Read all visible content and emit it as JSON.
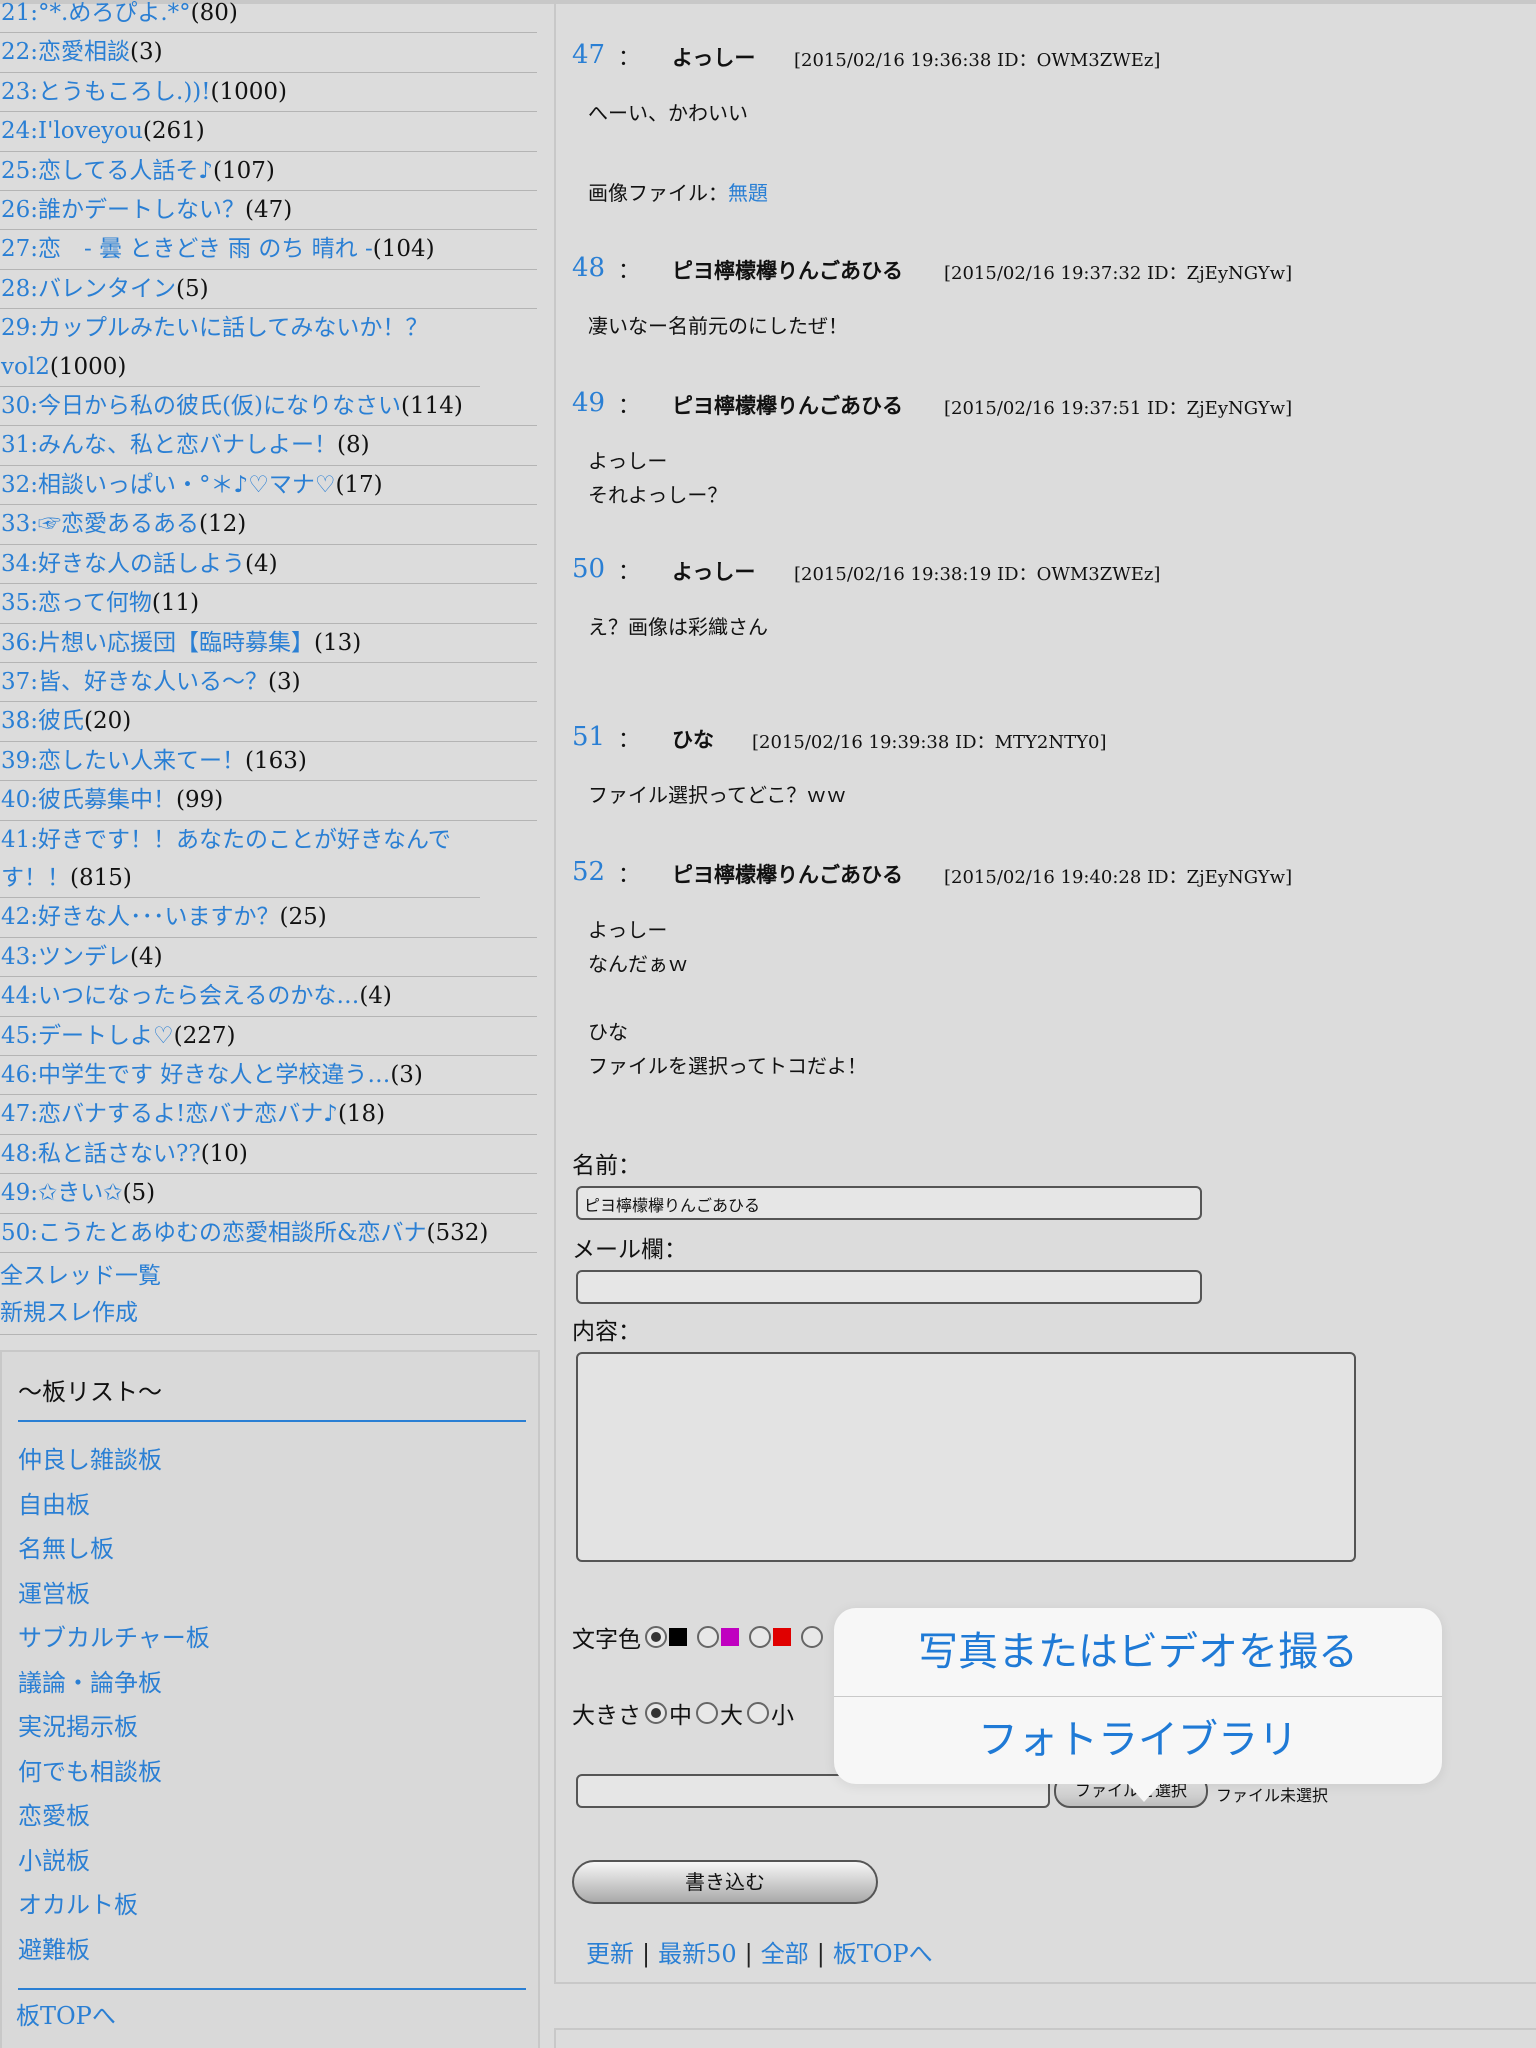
{
  "threads": [
    {
      "title": "21:°*.めろぴよ.*°",
      "count": "(80)"
    },
    {
      "title": "22:恋愛相談",
      "count": "(3)"
    },
    {
      "title": "23:とうもころし.))!",
      "count": "(1000)"
    },
    {
      "title": "24:I'loveyou",
      "count": "(261)"
    },
    {
      "title": "25:恋してる人話そ♪",
      "count": "(107)"
    },
    {
      "title": "26:誰かデートしない？",
      "count": "(47)"
    },
    {
      "title": "27:恋　- 曇 ときどき 雨 のち 晴れ -",
      "count": "(104)"
    },
    {
      "title": "28:バレンタイン",
      "count": "(5)"
    },
    {
      "title": "29:カップルみたいに話してみないか！？vol2",
      "count": "(1000)"
    },
    {
      "title": "30:今日から私の彼氏(仮)になりなさい",
      "count": "(114)"
    },
    {
      "title": "31:みんな、私と恋バナしよー！",
      "count": "(8)"
    },
    {
      "title": "32:相談いっぱい・°＊♪♡マナ♡",
      "count": "(17)"
    },
    {
      "title": "33:☞恋愛あるある",
      "count": "(12)"
    },
    {
      "title": "34:好きな人の話しよう",
      "count": "(4)"
    },
    {
      "title": "35:恋って何物",
      "count": "(11)"
    },
    {
      "title": "36:片想い応援団【臨時募集】",
      "count": "(13)"
    },
    {
      "title": "37:皆、好きな人いる〜？",
      "count": "(3)"
    },
    {
      "title": "38:彼氏",
      "count": "(20)"
    },
    {
      "title": "39:恋したい人来てー！",
      "count": "(163)"
    },
    {
      "title": "40:彼氏募集中！",
      "count": "(99)"
    },
    {
      "title": "41:好きです！！あなたのことが好きなんです！！",
      "count": "(815)"
    },
    {
      "title": "42:好きな人･･･いますか？",
      "count": "(25)"
    },
    {
      "title": "43:ツンデレ",
      "count": "(4)"
    },
    {
      "title": "44:いつになったら会えるのかな…",
      "count": "(4)"
    },
    {
      "title": "45:デートしよ♡",
      "count": "(227)"
    },
    {
      "title": "46:中学生です 好きな人と学校違う…",
      "count": "(3)"
    },
    {
      "title": "47:恋バナするよ!恋バナ恋バナ♪",
      "count": "(18)"
    },
    {
      "title": "48:私と話さない??",
      "count": "(10)"
    },
    {
      "title": "49:✩きい✩",
      "count": "(5)"
    },
    {
      "title": "50:こうたとあゆむの恋愛相談所&恋バナ",
      "count": "(532)"
    }
  ],
  "left_links": {
    "all_threads": "全スレッド一覧",
    "new_thread": "新規スレ作成"
  },
  "boards": {
    "title": "〜板リスト〜",
    "items": [
      "仲良し雑談板",
      "自由板",
      "名無し板",
      "運営板",
      "サブカルチャー板",
      "議論・論争板",
      "実況掲示板",
      "何でも相談板",
      "恋愛板",
      "小説板",
      "オカルト板",
      "避難板"
    ],
    "top_link": "板TOPへ"
  },
  "posts": [
    {
      "num": "47",
      "colon": "：",
      "name": "よっしー",
      "meta": "[2015/02/16 19:36:38 ID：OWM3ZWEz]",
      "body": "へーい、かわいい",
      "image_label": "画像ファイル：",
      "image_link": "無題"
    },
    {
      "num": "48",
      "colon": "：",
      "name": "ピヨ檸檬欅りんごあひる",
      "meta": "[2015/02/16 19:37:32 ID：ZjEyNGYw]",
      "body": "凄いなー名前元のにしたぜ！"
    },
    {
      "num": "49",
      "colon": "：",
      "name": "ピヨ檸檬欅りんごあひる",
      "meta": "[2015/02/16 19:37:51 ID：ZjEyNGYw]",
      "body": "よっしー\nそれよっしー？"
    },
    {
      "num": "50",
      "colon": "：",
      "name": "よっしー",
      "meta": "[2015/02/16 19:38:19 ID：OWM3ZWEz]",
      "body": "え？画像は彩織さん"
    },
    {
      "num": "51",
      "colon": "：",
      "name": "ひな",
      "meta": "[2015/02/16 19:39:38 ID：MTY2NTY0]",
      "body": "ファイル選択ってどこ？ｗｗ"
    },
    {
      "num": "52",
      "colon": "：",
      "name": "ピヨ檸檬欅りんごあひる",
      "meta": "[2015/02/16 19:40:28 ID：ZjEyNGYw]",
      "body": "よっしー\nなんだぁｗ\n\nひな\nファイルを選択ってトコだよ！"
    }
  ],
  "form": {
    "name_label": "名前：",
    "name_value": "ピヨ檸檬欅りんごあひる",
    "mail_label": "メール欄：",
    "mail_value": "",
    "content_label": "内容：",
    "color_label": "文字色",
    "color_swatches": [
      "#000000",
      "#c000c0",
      "#e00000"
    ],
    "size_label": "大きさ",
    "size_options": [
      "中",
      "大",
      "小"
    ],
    "file_button": "ファイルを選択",
    "file_status": "ファイル未選択",
    "submit": "書き込む"
  },
  "footer_nav": {
    "reload": "更新",
    "latest50": "最新50",
    "all": "全部",
    "board_top": "板TOPへ",
    "sep": "|"
  },
  "popover": {
    "take_photo": "写真またはビデオを撮る",
    "photo_library": "フォトライブラリ"
  },
  "colors": {
    "link": "#2a7fd4",
    "background": "#dcdcdc",
    "popover_bg": "#f7f7f7",
    "popover_text": "#1f7ad6"
  }
}
